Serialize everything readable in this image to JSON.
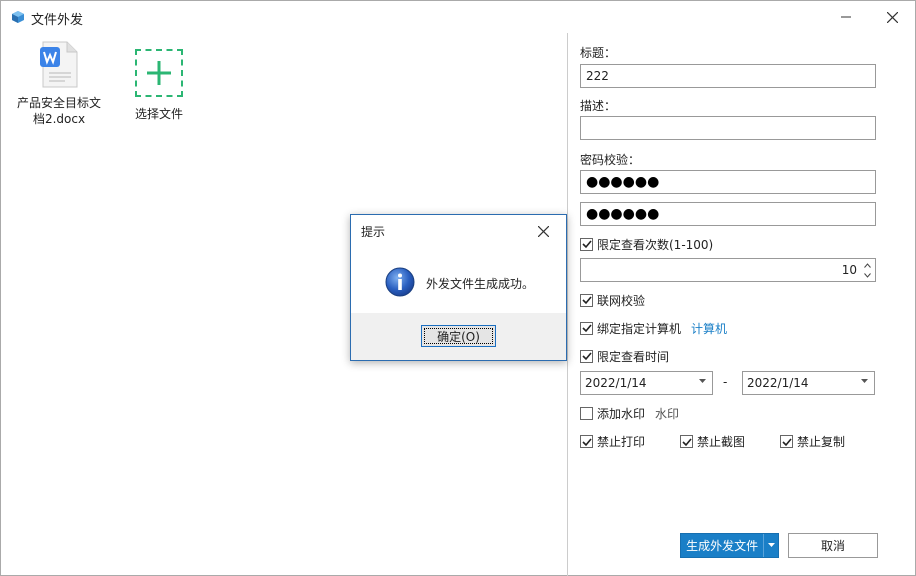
{
  "window": {
    "title": "文件外发"
  },
  "files": [
    {
      "name": "产品安全目标文档2.docx",
      "line1": "产品安全目标文",
      "line2": "档2.docx",
      "icon": "wps-word-doc-icon"
    }
  ],
  "add_file": {
    "label": "选择文件"
  },
  "form": {
    "title_label": "标题：",
    "title_value": "222",
    "desc_label": "描述：",
    "desc_value": "",
    "pw_label": "密码校验：",
    "pw1": "●●●●●●",
    "pw2": "●●●●●●",
    "limit_views_label": "限定查看次数(1-100)",
    "limit_views_checked": true,
    "limit_views_value": "10",
    "online_check_label": "联网校验",
    "online_check_checked": true,
    "bind_pc_label": "绑定指定计算机",
    "bind_pc_checked": true,
    "bind_pc_link": "计算机",
    "limit_time_label": "限定查看时间",
    "limit_time_checked": true,
    "date_from": "2022/1/14",
    "date_sep": "-",
    "date_to": "2022/1/14",
    "watermark_label": "添加水印",
    "watermark_checked": false,
    "watermark_link": "水印",
    "no_print_label": "禁止打印",
    "no_print_checked": true,
    "no_screenshot_label": "禁止截图",
    "no_screenshot_checked": true,
    "no_copy_label": "禁止复制",
    "no_copy_checked": true
  },
  "buttons": {
    "generate": "生成外发文件",
    "cancel": "取消"
  },
  "dialog": {
    "title": "提示",
    "message": "外发文件生成成功。",
    "ok": "确定(O)",
    "icon": "info-icon"
  },
  "colors": {
    "accent": "#1a7fc7",
    "add_green": "#2bb673",
    "dialog_border": "#2b6cb0"
  }
}
